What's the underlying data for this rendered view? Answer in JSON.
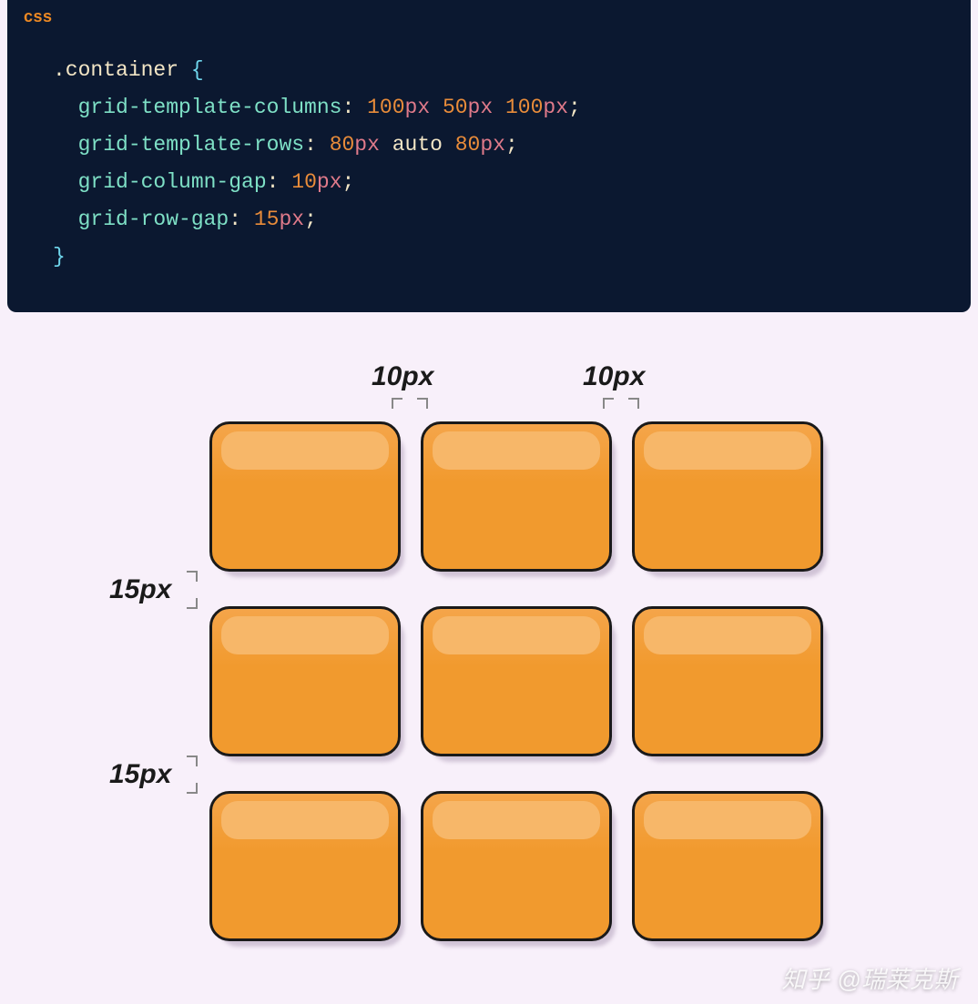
{
  "code": {
    "language": "css",
    "selector": ".container",
    "open_brace": "{",
    "close_brace": "}",
    "lines": [
      {
        "prop": "grid-template-columns",
        "colon": ":",
        "parts": [
          {
            "num": "100",
            "unit": "px"
          },
          {
            "num": "50",
            "unit": "px"
          },
          {
            "num": "100",
            "unit": "px"
          }
        ],
        "semi": ";"
      },
      {
        "prop": "grid-template-rows",
        "colon": ":",
        "parts": [
          {
            "num": "80",
            "unit": "px"
          },
          {
            "kw": "auto"
          },
          {
            "num": "80",
            "unit": "px"
          }
        ],
        "semi": ";"
      },
      {
        "prop": "grid-column-gap",
        "colon": ":",
        "parts": [
          {
            "num": "10",
            "unit": "px"
          }
        ],
        "semi": ";"
      },
      {
        "prop": "grid-row-gap",
        "colon": ":",
        "parts": [
          {
            "num": "15",
            "unit": "px"
          }
        ],
        "semi": ";"
      }
    ]
  },
  "diagram": {
    "col_gap_label_1": "10px",
    "col_gap_label_2": "10px",
    "row_gap_label_1": "15px",
    "row_gap_label_2": "15px"
  },
  "watermark": "知乎 @瑞莱克斯"
}
